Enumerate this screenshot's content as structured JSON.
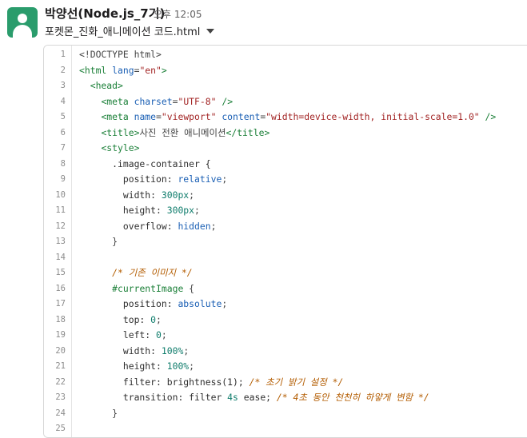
{
  "header": {
    "sender": "박양선(Node.js_7기)",
    "time": "오후 12:05",
    "file_name": "포켓몬_진화_애니메이션 코드.html"
  },
  "colors": {
    "avatar_bg": "#2a9c6c",
    "tag": "#1a7f37",
    "attr": "#1a5fb4",
    "string": "#a32626",
    "comment": "#b35c00"
  },
  "code_lines": [
    {
      "n": "1",
      "tokens": [
        {
          "t": "<!DOCTYPE html>",
          "c": "t-punc"
        }
      ]
    },
    {
      "n": "2",
      "tokens": [
        {
          "t": "<html ",
          "c": "t-tag"
        },
        {
          "t": "lang",
          "c": "t-attr"
        },
        {
          "t": "=",
          "c": "t-punc"
        },
        {
          "t": "\"en\"",
          "c": "t-str"
        },
        {
          "t": ">",
          "c": "t-tag"
        }
      ]
    },
    {
      "n": "3",
      "tokens": [
        {
          "t": "  ",
          "c": ""
        },
        {
          "t": "<head>",
          "c": "t-tag"
        }
      ]
    },
    {
      "n": "4",
      "tokens": [
        {
          "t": "    ",
          "c": ""
        },
        {
          "t": "<meta ",
          "c": "t-tag"
        },
        {
          "t": "charset",
          "c": "t-attr"
        },
        {
          "t": "=",
          "c": "t-punc"
        },
        {
          "t": "\"UTF-8\"",
          "c": "t-str"
        },
        {
          "t": " />",
          "c": "t-tag"
        }
      ]
    },
    {
      "n": "5",
      "tokens": [
        {
          "t": "    ",
          "c": ""
        },
        {
          "t": "<meta ",
          "c": "t-tag"
        },
        {
          "t": "name",
          "c": "t-attr"
        },
        {
          "t": "=",
          "c": "t-punc"
        },
        {
          "t": "\"viewport\"",
          "c": "t-str"
        },
        {
          "t": " ",
          "c": ""
        },
        {
          "t": "content",
          "c": "t-attr"
        },
        {
          "t": "=",
          "c": "t-punc"
        },
        {
          "t": "\"width=device-width, initial-scale=1.0\"",
          "c": "t-str"
        },
        {
          "t": " />",
          "c": "t-tag"
        }
      ]
    },
    {
      "n": "6",
      "tokens": [
        {
          "t": "    ",
          "c": ""
        },
        {
          "t": "<title>",
          "c": "t-tag"
        },
        {
          "t": "사진 전환 애니메이션",
          "c": "t-punc"
        },
        {
          "t": "</title>",
          "c": "t-tag"
        }
      ]
    },
    {
      "n": "7",
      "tokens": [
        {
          "t": "    ",
          "c": ""
        },
        {
          "t": "<style>",
          "c": "t-tag"
        }
      ]
    },
    {
      "n": "8",
      "tokens": [
        {
          "t": "      .image-container {",
          "c": "t-sel"
        }
      ]
    },
    {
      "n": "9",
      "tokens": [
        {
          "t": "        position: ",
          "c": "t-prop"
        },
        {
          "t": "relative",
          "c": "t-val"
        },
        {
          "t": ";",
          "c": "t-punc"
        }
      ]
    },
    {
      "n": "10",
      "tokens": [
        {
          "t": "        width: ",
          "c": "t-prop"
        },
        {
          "t": "300px",
          "c": "t-num"
        },
        {
          "t": ";",
          "c": "t-punc"
        }
      ]
    },
    {
      "n": "11",
      "tokens": [
        {
          "t": "        height: ",
          "c": "t-prop"
        },
        {
          "t": "300px",
          "c": "t-num"
        },
        {
          "t": ";",
          "c": "t-punc"
        }
      ]
    },
    {
      "n": "12",
      "tokens": [
        {
          "t": "        overflow: ",
          "c": "t-prop"
        },
        {
          "t": "hidden",
          "c": "t-val"
        },
        {
          "t": ";",
          "c": "t-punc"
        }
      ]
    },
    {
      "n": "13",
      "tokens": [
        {
          "t": "      }",
          "c": "t-punc"
        }
      ]
    },
    {
      "n": "14",
      "tokens": [
        {
          "t": "",
          "c": ""
        }
      ]
    },
    {
      "n": "15",
      "tokens": [
        {
          "t": "      ",
          "c": ""
        },
        {
          "t": "/* 기존 이미지 */",
          "c": "t-comment"
        }
      ]
    },
    {
      "n": "16",
      "tokens": [
        {
          "t": "      ",
          "c": ""
        },
        {
          "t": "#currentImage",
          "c": "t-id"
        },
        {
          "t": " {",
          "c": "t-punc"
        }
      ]
    },
    {
      "n": "17",
      "tokens": [
        {
          "t": "        position: ",
          "c": "t-prop"
        },
        {
          "t": "absolute",
          "c": "t-val"
        },
        {
          "t": ";",
          "c": "t-punc"
        }
      ]
    },
    {
      "n": "18",
      "tokens": [
        {
          "t": "        top: ",
          "c": "t-prop"
        },
        {
          "t": "0",
          "c": "t-num"
        },
        {
          "t": ";",
          "c": "t-punc"
        }
      ]
    },
    {
      "n": "19",
      "tokens": [
        {
          "t": "        left: ",
          "c": "t-prop"
        },
        {
          "t": "0",
          "c": "t-num"
        },
        {
          "t": ";",
          "c": "t-punc"
        }
      ]
    },
    {
      "n": "20",
      "tokens": [
        {
          "t": "        width: ",
          "c": "t-prop"
        },
        {
          "t": "100%",
          "c": "t-num"
        },
        {
          "t": ";",
          "c": "t-punc"
        }
      ]
    },
    {
      "n": "21",
      "tokens": [
        {
          "t": "        height: ",
          "c": "t-prop"
        },
        {
          "t": "100%",
          "c": "t-num"
        },
        {
          "t": ";",
          "c": "t-punc"
        }
      ]
    },
    {
      "n": "22",
      "tokens": [
        {
          "t": "        filter: brightness(1); ",
          "c": "t-prop"
        },
        {
          "t": "/* 초기 밝기 설정 */",
          "c": "t-comment"
        }
      ]
    },
    {
      "n": "23",
      "tokens": [
        {
          "t": "        transition: filter ",
          "c": "t-prop"
        },
        {
          "t": "4s",
          "c": "t-num"
        },
        {
          "t": " ease; ",
          "c": "t-prop"
        },
        {
          "t": "/* 4초 동안 천천히 하얗게 변함 */",
          "c": "t-comment"
        }
      ]
    },
    {
      "n": "24",
      "tokens": [
        {
          "t": "      }",
          "c": "t-punc"
        }
      ]
    },
    {
      "n": "25",
      "tokens": [
        {
          "t": "",
          "c": ""
        }
      ]
    }
  ]
}
